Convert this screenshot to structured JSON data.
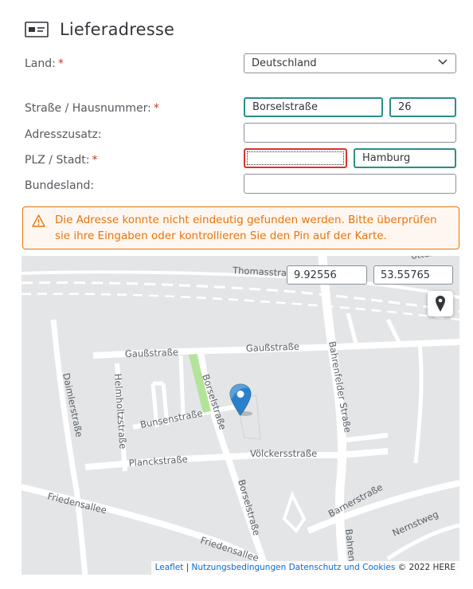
{
  "header": {
    "title": "Lieferadresse",
    "icon": "address-card-icon"
  },
  "form": {
    "country": {
      "label": "Land:",
      "required_mark": "*",
      "value": "Deutschland"
    },
    "street": {
      "label": "Straße / Hausnummer:",
      "required_mark": "*",
      "street_value": "Borselstraße",
      "number_value": "26"
    },
    "address_extra": {
      "label": "Adresszusatz:",
      "value": ""
    },
    "zip_city": {
      "label": "PLZ / Stadt:",
      "required_mark": "*",
      "zip_value": "",
      "city_value": "Hamburg"
    },
    "state": {
      "label": "Bundesland:",
      "value": ""
    }
  },
  "alert": {
    "text": "Die Adresse konnte nicht eindeutig gefunden werden. Bitte überprüfen sie ihre Eingaben oder kontrollieren Sie den Pin auf der Karte.",
    "color": "#e9730c"
  },
  "map": {
    "longitude": "9.92556",
    "latitude": "53.55765",
    "streets": {
      "thomas": "Thomasstraße",
      "gauss_left": "Gaußstraße",
      "gauss_right": "Gaußstraße",
      "bahrenfelder": "Bahrenfelder Straße",
      "daimler": "Daimlerstraße",
      "helmholtz": "Helmholtzstraße",
      "borsel_top": "Borselstraße",
      "bunsen": "Bunsenstraße",
      "planck": "Planckstraße",
      "voelckers": "Völckersstraße",
      "friedensallee_left": "Friedensallee",
      "friedensallee_bottom": "Friedensallee",
      "borsel_bottom": "Borselstraße",
      "barner": "Barnerstraße",
      "nernst": "Nernstweg",
      "bahrenfelder_bottom": "Bahren",
      "top_right": "ottentwiete"
    },
    "attribution": {
      "leaflet": "Leaflet",
      "sep": " | ",
      "terms": "Nutzungsbedingungen",
      "privacy": "Datenschutz und Cookies",
      "copyright": " © 2022 HERE"
    }
  }
}
